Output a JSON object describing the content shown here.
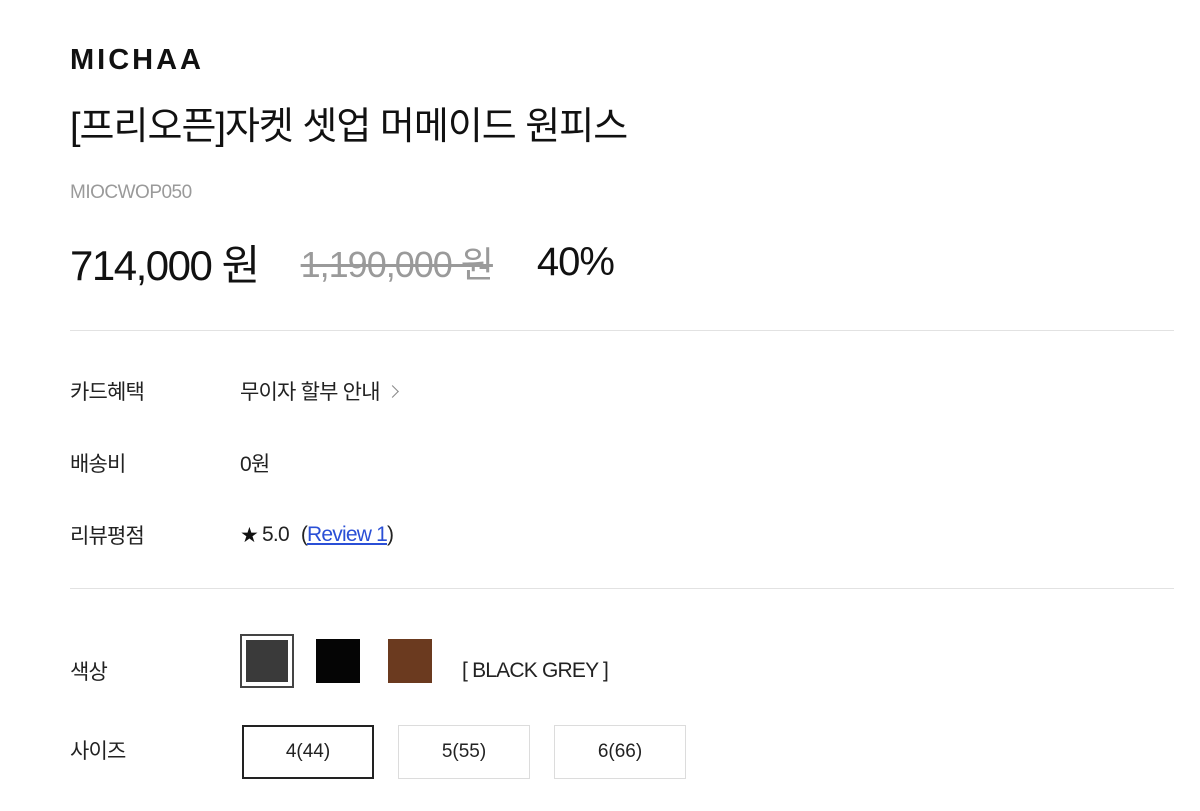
{
  "product": {
    "brand": "MICHAA",
    "title": "[프리오픈]자켓 셋업 머메이드 원피스",
    "code": "MIOCWOP050",
    "price": "714,000 원",
    "original_price": "1,190,000 원",
    "discount": "40%"
  },
  "info": {
    "card_label": "카드혜택",
    "card_value": "무이자 할부 안내",
    "shipping_label": "배송비",
    "shipping_value": "0원",
    "review_label": "리뷰평점",
    "rating": "5.0",
    "review_open": "(",
    "review_link": "Review 1",
    "review_close": ")"
  },
  "options": {
    "color_label": "색상",
    "colors": [
      {
        "name": "BLACK GREY",
        "hex": "#3a3a3a",
        "selected": true
      },
      {
        "name": "BLACK",
        "hex": "#050505",
        "selected": false
      },
      {
        "name": "BROWN",
        "hex": "#6b3a1f",
        "selected": false
      }
    ],
    "selected_color_text": "[ BLACK GREY ]",
    "size_label": "사이즈",
    "sizes": [
      "4(44)",
      "5(55)",
      "6(66)"
    ],
    "selected_size": "4(44)"
  },
  "icons": {
    "chevron": "chevron-right-icon",
    "star": "star-icon"
  },
  "colors": {
    "text": "#111111",
    "muted": "#9a9a9a",
    "link": "#2a4fd6",
    "divider": "#e2e2e2"
  }
}
